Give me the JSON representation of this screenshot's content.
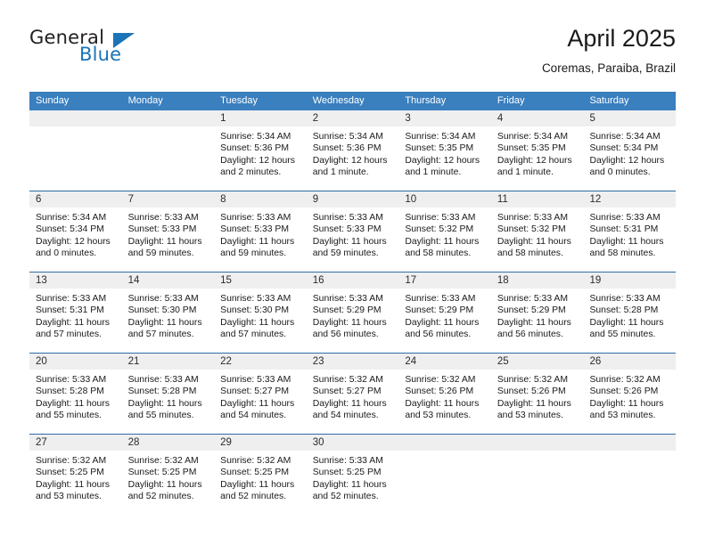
{
  "brand": {
    "logo_text_primary": "General",
    "logo_text_secondary": "Blue",
    "accent_color": "#1b73b8"
  },
  "header": {
    "title": "April 2025",
    "subtitle": "Coremas, Paraiba, Brazil"
  },
  "theme": {
    "header_row_color": "#3a7fbe",
    "row_divider_color": "#2e6da4",
    "day_band_color": "#efefef"
  },
  "weekdays": [
    "Sunday",
    "Monday",
    "Tuesday",
    "Wednesday",
    "Thursday",
    "Friday",
    "Saturday"
  ],
  "weeks": [
    [
      {
        "day": "",
        "sunrise": "",
        "sunset": "",
        "daylight": ""
      },
      {
        "day": "",
        "sunrise": "",
        "sunset": "",
        "daylight": ""
      },
      {
        "day": "1",
        "sunrise": "Sunrise: 5:34 AM",
        "sunset": "Sunset: 5:36 PM",
        "daylight": "Daylight: 12 hours and 2 minutes."
      },
      {
        "day": "2",
        "sunrise": "Sunrise: 5:34 AM",
        "sunset": "Sunset: 5:36 PM",
        "daylight": "Daylight: 12 hours and 1 minute."
      },
      {
        "day": "3",
        "sunrise": "Sunrise: 5:34 AM",
        "sunset": "Sunset: 5:35 PM",
        "daylight": "Daylight: 12 hours and 1 minute."
      },
      {
        "day": "4",
        "sunrise": "Sunrise: 5:34 AM",
        "sunset": "Sunset: 5:35 PM",
        "daylight": "Daylight: 12 hours and 1 minute."
      },
      {
        "day": "5",
        "sunrise": "Sunrise: 5:34 AM",
        "sunset": "Sunset: 5:34 PM",
        "daylight": "Daylight: 12 hours and 0 minutes."
      }
    ],
    [
      {
        "day": "6",
        "sunrise": "Sunrise: 5:34 AM",
        "sunset": "Sunset: 5:34 PM",
        "daylight": "Daylight: 12 hours and 0 minutes."
      },
      {
        "day": "7",
        "sunrise": "Sunrise: 5:33 AM",
        "sunset": "Sunset: 5:33 PM",
        "daylight": "Daylight: 11 hours and 59 minutes."
      },
      {
        "day": "8",
        "sunrise": "Sunrise: 5:33 AM",
        "sunset": "Sunset: 5:33 PM",
        "daylight": "Daylight: 11 hours and 59 minutes."
      },
      {
        "day": "9",
        "sunrise": "Sunrise: 5:33 AM",
        "sunset": "Sunset: 5:33 PM",
        "daylight": "Daylight: 11 hours and 59 minutes."
      },
      {
        "day": "10",
        "sunrise": "Sunrise: 5:33 AM",
        "sunset": "Sunset: 5:32 PM",
        "daylight": "Daylight: 11 hours and 58 minutes."
      },
      {
        "day": "11",
        "sunrise": "Sunrise: 5:33 AM",
        "sunset": "Sunset: 5:32 PM",
        "daylight": "Daylight: 11 hours and 58 minutes."
      },
      {
        "day": "12",
        "sunrise": "Sunrise: 5:33 AM",
        "sunset": "Sunset: 5:31 PM",
        "daylight": "Daylight: 11 hours and 58 minutes."
      }
    ],
    [
      {
        "day": "13",
        "sunrise": "Sunrise: 5:33 AM",
        "sunset": "Sunset: 5:31 PM",
        "daylight": "Daylight: 11 hours and 57 minutes."
      },
      {
        "day": "14",
        "sunrise": "Sunrise: 5:33 AM",
        "sunset": "Sunset: 5:30 PM",
        "daylight": "Daylight: 11 hours and 57 minutes."
      },
      {
        "day": "15",
        "sunrise": "Sunrise: 5:33 AM",
        "sunset": "Sunset: 5:30 PM",
        "daylight": "Daylight: 11 hours and 57 minutes."
      },
      {
        "day": "16",
        "sunrise": "Sunrise: 5:33 AM",
        "sunset": "Sunset: 5:29 PM",
        "daylight": "Daylight: 11 hours and 56 minutes."
      },
      {
        "day": "17",
        "sunrise": "Sunrise: 5:33 AM",
        "sunset": "Sunset: 5:29 PM",
        "daylight": "Daylight: 11 hours and 56 minutes."
      },
      {
        "day": "18",
        "sunrise": "Sunrise: 5:33 AM",
        "sunset": "Sunset: 5:29 PM",
        "daylight": "Daylight: 11 hours and 56 minutes."
      },
      {
        "day": "19",
        "sunrise": "Sunrise: 5:33 AM",
        "sunset": "Sunset: 5:28 PM",
        "daylight": "Daylight: 11 hours and 55 minutes."
      }
    ],
    [
      {
        "day": "20",
        "sunrise": "Sunrise: 5:33 AM",
        "sunset": "Sunset: 5:28 PM",
        "daylight": "Daylight: 11 hours and 55 minutes."
      },
      {
        "day": "21",
        "sunrise": "Sunrise: 5:33 AM",
        "sunset": "Sunset: 5:28 PM",
        "daylight": "Daylight: 11 hours and 55 minutes."
      },
      {
        "day": "22",
        "sunrise": "Sunrise: 5:33 AM",
        "sunset": "Sunset: 5:27 PM",
        "daylight": "Daylight: 11 hours and 54 minutes."
      },
      {
        "day": "23",
        "sunrise": "Sunrise: 5:32 AM",
        "sunset": "Sunset: 5:27 PM",
        "daylight": "Daylight: 11 hours and 54 minutes."
      },
      {
        "day": "24",
        "sunrise": "Sunrise: 5:32 AM",
        "sunset": "Sunset: 5:26 PM",
        "daylight": "Daylight: 11 hours and 53 minutes."
      },
      {
        "day": "25",
        "sunrise": "Sunrise: 5:32 AM",
        "sunset": "Sunset: 5:26 PM",
        "daylight": "Daylight: 11 hours and 53 minutes."
      },
      {
        "day": "26",
        "sunrise": "Sunrise: 5:32 AM",
        "sunset": "Sunset: 5:26 PM",
        "daylight": "Daylight: 11 hours and 53 minutes."
      }
    ],
    [
      {
        "day": "27",
        "sunrise": "Sunrise: 5:32 AM",
        "sunset": "Sunset: 5:25 PM",
        "daylight": "Daylight: 11 hours and 53 minutes."
      },
      {
        "day": "28",
        "sunrise": "Sunrise: 5:32 AM",
        "sunset": "Sunset: 5:25 PM",
        "daylight": "Daylight: 11 hours and 52 minutes."
      },
      {
        "day": "29",
        "sunrise": "Sunrise: 5:32 AM",
        "sunset": "Sunset: 5:25 PM",
        "daylight": "Daylight: 11 hours and 52 minutes."
      },
      {
        "day": "30",
        "sunrise": "Sunrise: 5:33 AM",
        "sunset": "Sunset: 5:25 PM",
        "daylight": "Daylight: 11 hours and 52 minutes."
      },
      {
        "day": "",
        "sunrise": "",
        "sunset": "",
        "daylight": ""
      },
      {
        "day": "",
        "sunrise": "",
        "sunset": "",
        "daylight": ""
      },
      {
        "day": "",
        "sunrise": "",
        "sunset": "",
        "daylight": ""
      }
    ]
  ]
}
